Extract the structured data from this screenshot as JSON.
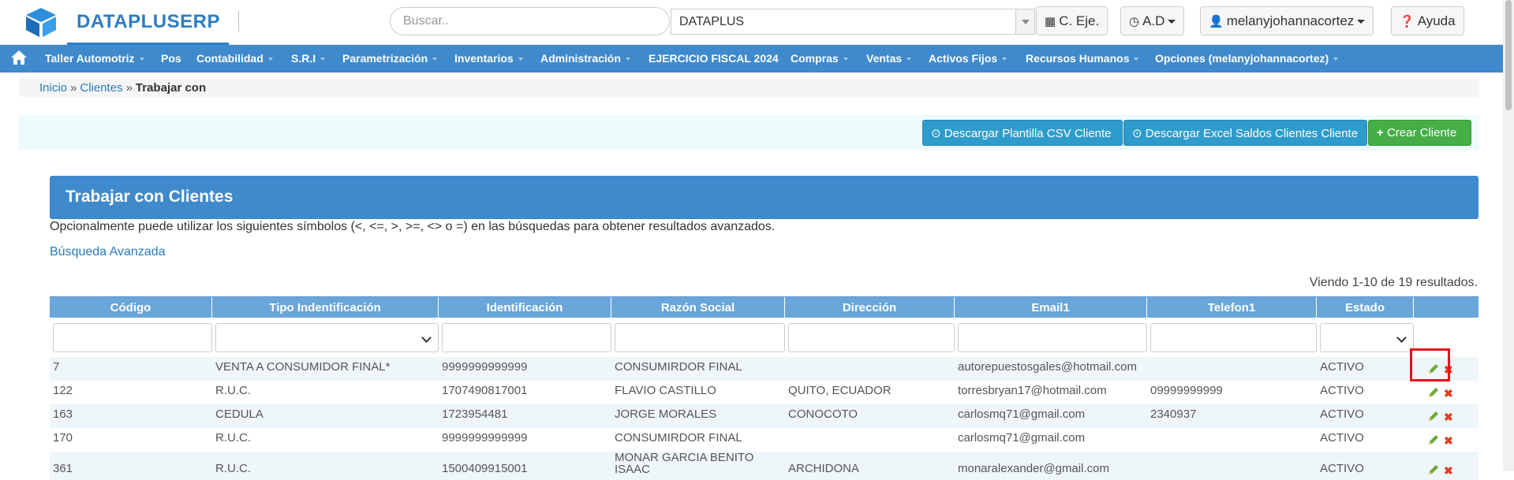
{
  "brand": {
    "name": "DATAPLUSERP"
  },
  "search": {
    "placeholder": "Buscar.."
  },
  "company_select": {
    "value": "DATAPLUS"
  },
  "top_buttons": {
    "fiscal": "C. Eje.",
    "ad": "A.D",
    "user": "melanyjohannacortez",
    "help": "Ayuda"
  },
  "nav": {
    "items": [
      "Taller Automotriz",
      "Pos",
      "Contabilidad",
      "S.R.I",
      "Parametrización",
      "Inventarios",
      "Administración",
      "EJERCICIO FISCAL 2024",
      "Compras",
      "Ventas",
      "Activos Fijos",
      "Recursos Humanos",
      "Opciones (melanyjohannacortez)"
    ]
  },
  "breadcrumb": {
    "home": "Inicio",
    "sep": "»",
    "clients": "Clientes",
    "current": "Trabajar con"
  },
  "actions": {
    "csv": "Descargar Plantilla CSV Cliente",
    "excel": "Descargar Excel Saldos Clientes Cliente",
    "create": "Crear Cliente"
  },
  "panel": {
    "title": "Trabajar con Clientes",
    "hint": "Opcionalmente puede utilizar los siguientes símbolos (<, <=, >, >=, <> o =) en las búsquedas para obtener resultados avanzados.",
    "advanced": "Búsqueda Avanzada",
    "summary": "Viendo 1-10 de 19 resultados."
  },
  "table": {
    "columns": [
      "Código",
      "Tipo Indentificación",
      "Identificación",
      "Razón Social",
      "Dirección",
      "Email1",
      "Telefon1",
      "Estado"
    ],
    "rows": [
      [
        "7",
        "VENTA A CONSUMIDOR FINAL*",
        "9999999999999",
        "CONSUMIRDOR FINAL",
        "",
        "autorepuestosgales@hotmail.com",
        "",
        "ACTIVO"
      ],
      [
        "122",
        "R.U.C.",
        "1707490817001",
        "FLAVIO CASTILLO",
        "QUITO, ECUADOR",
        "torresbryan17@hotmail.com",
        "09999999999",
        "ACTIVO"
      ],
      [
        "163",
        "CEDULA",
        "1723954481",
        "JORGE MORALES",
        "CONOCOTO",
        "carlosmq71@gmail.com",
        "2340937",
        "ACTIVO"
      ],
      [
        "170",
        "R.U.C.",
        "9999999999999",
        "CONSUMIRDOR FINAL",
        "",
        "carlosmq71@gmail.com",
        "",
        "ACTIVO"
      ],
      [
        "361",
        "R.U.C.",
        "1500409915001",
        "MONAR GARCIA BENITO ISAAC",
        "ARCHIDONA",
        "monaralexander@gmail.com",
        "",
        "ACTIVO"
      ]
    ]
  },
  "colors": {
    "primary": "#3e8acc",
    "header": "#6aa6da",
    "info": "#2e9ccb",
    "success": "#46ae46",
    "highlight": "#e8101a"
  }
}
